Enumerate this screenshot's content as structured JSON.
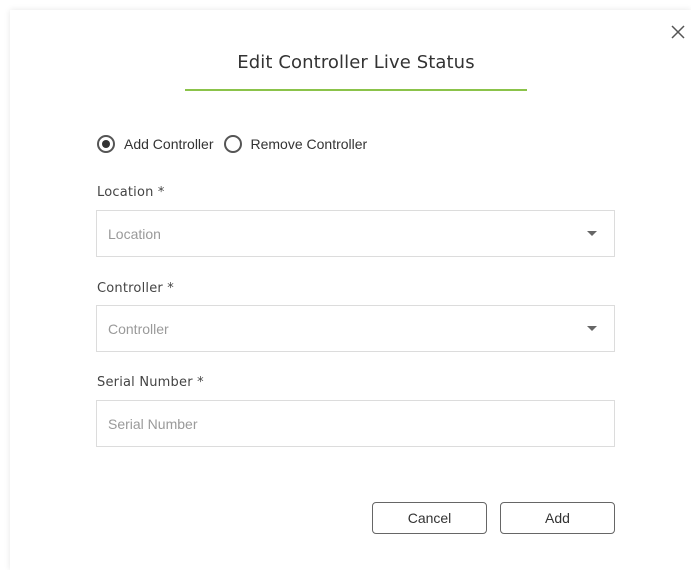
{
  "dialog": {
    "title": "Edit Controller Live Status",
    "accent_color": "#8bc34a"
  },
  "mode": {
    "options": [
      {
        "label": "Add Controller",
        "selected": true
      },
      {
        "label": "Remove Controller",
        "selected": false
      }
    ]
  },
  "fields": {
    "location": {
      "label": "Location *",
      "placeholder": "Location"
    },
    "controller": {
      "label": "Controller *",
      "placeholder": "Controller"
    },
    "serial": {
      "label": "Serial Number *",
      "placeholder": "Serial Number"
    }
  },
  "buttons": {
    "cancel": "Cancel",
    "add": "Add"
  },
  "icons": {
    "close": "close-icon",
    "caret": "caret-down-icon"
  }
}
